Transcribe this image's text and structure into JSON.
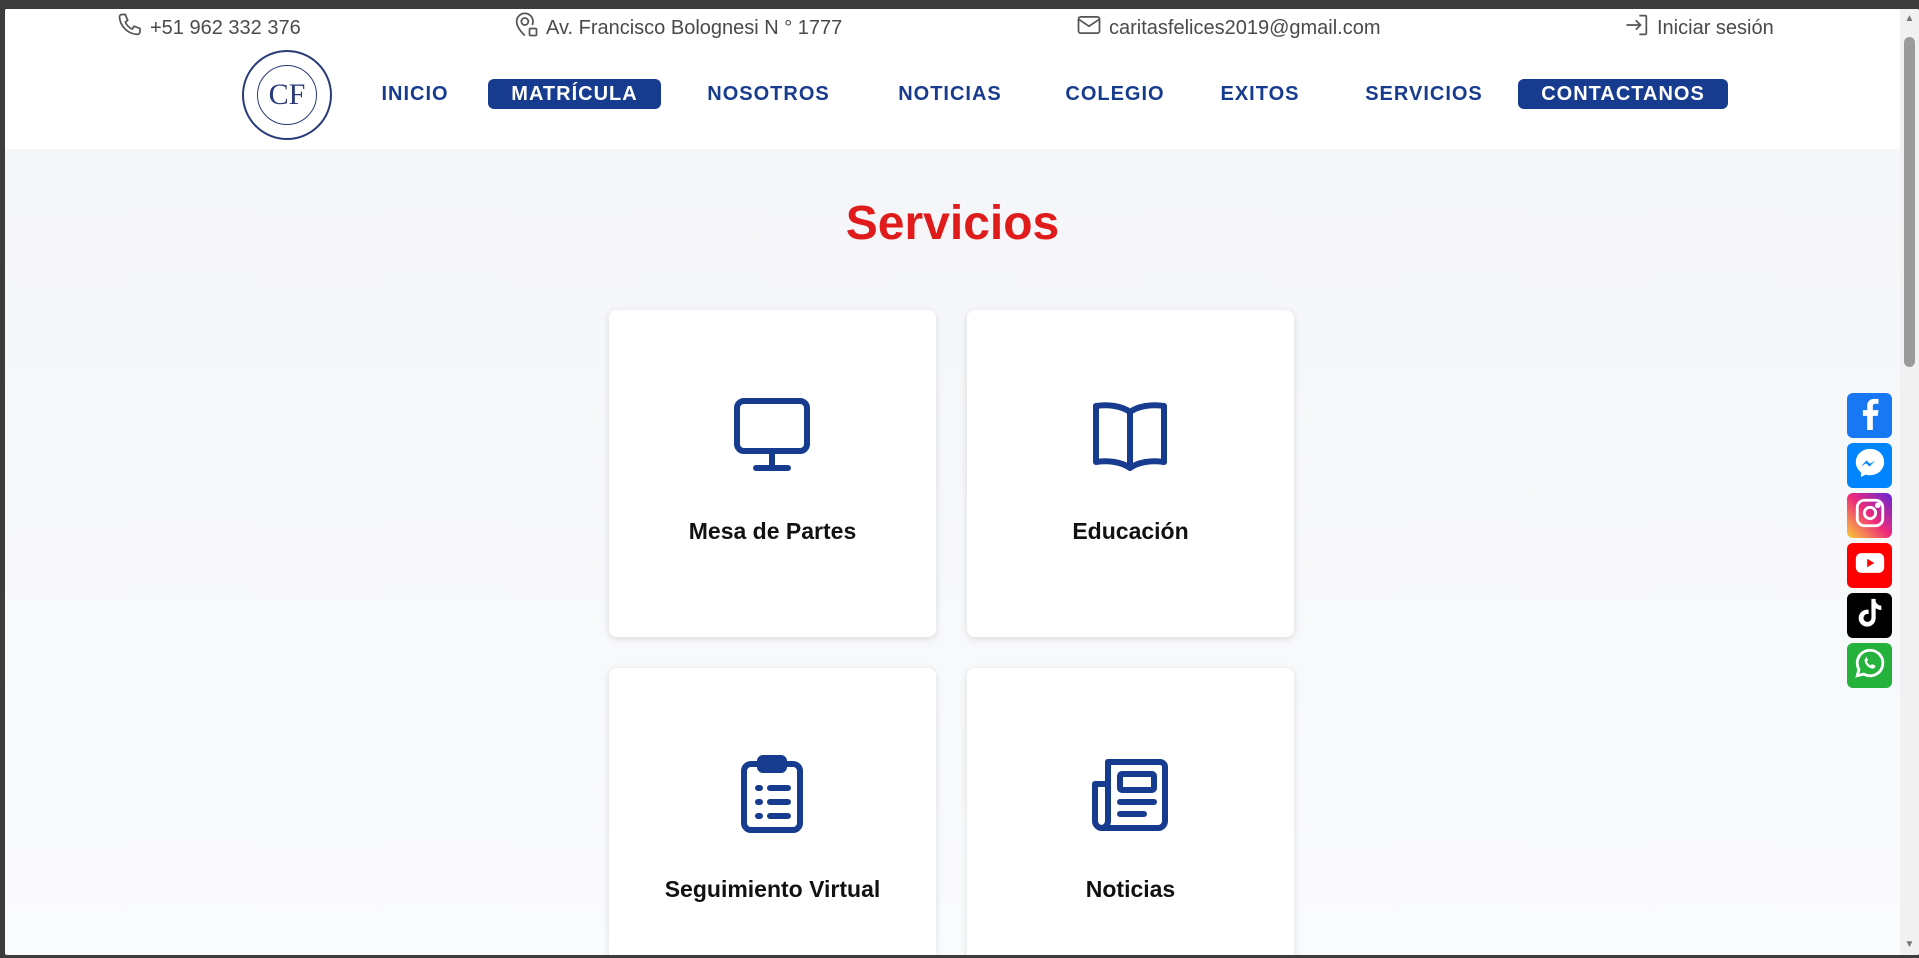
{
  "topbar": {
    "phone": "+51 962 332 376",
    "address": "Av. Francisco Bolognesi N ° 1777",
    "email": "caritasfelices2019@gmail.com",
    "login": "Iniciar sesión",
    "icons": [
      "phone-icon",
      "location-icon",
      "mail-icon",
      "login-icon"
    ]
  },
  "logo": {
    "initials": "CF"
  },
  "nav": {
    "items": [
      {
        "label": "INICIO",
        "active": false
      },
      {
        "label": "MATRÍCULA",
        "active": true
      },
      {
        "label": "NOSOTROS",
        "active": false
      },
      {
        "label": "NOTICIAS",
        "active": false
      },
      {
        "label": "COLEGIO",
        "active": false
      },
      {
        "label": "EXITOS",
        "active": false
      },
      {
        "label": "SERVICIOS",
        "active": false
      },
      {
        "label": "CONTACTANOS",
        "active": true
      }
    ]
  },
  "main": {
    "title": "Servicios",
    "cards": [
      {
        "label": "Mesa de Partes",
        "icon": "monitor-icon"
      },
      {
        "label": "Educación",
        "icon": "book-icon"
      },
      {
        "label": "Seguimiento Virtual",
        "icon": "clipboard-list-icon"
      },
      {
        "label": "Noticias",
        "icon": "newspaper-icon"
      }
    ]
  },
  "social": [
    {
      "name": "facebook-icon",
      "color": "#1877f2"
    },
    {
      "name": "messenger-icon",
      "color": "#0084ff"
    },
    {
      "name": "instagram-icon",
      "color": "#e1306c"
    },
    {
      "name": "youtube-icon",
      "color": "#ff0000"
    },
    {
      "name": "tiktok-icon",
      "color": "#000000"
    },
    {
      "name": "whatsapp-icon",
      "color": "#25d366"
    }
  ],
  "colors": {
    "brand_blue": "#173b8e",
    "heading_red": "#e01b1b"
  }
}
